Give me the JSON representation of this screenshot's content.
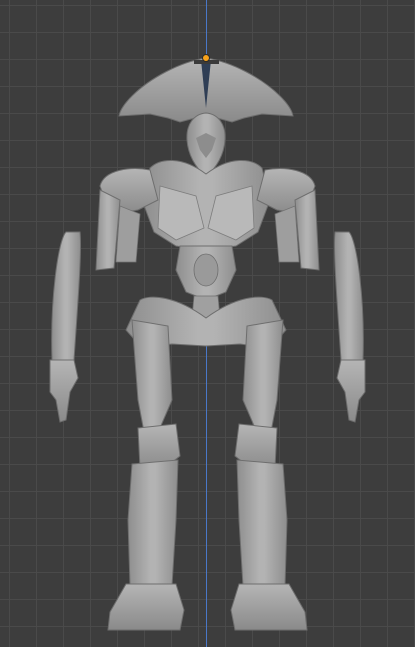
{
  "viewport": {
    "background_color": "#3d3d3d",
    "grid_color": "#4b4b4b",
    "axis_color": "#4a78c8",
    "origin_color": "#f7a21b"
  },
  "model": {
    "icon": "robot-mesh",
    "surface_color": "#a8a8a8",
    "shadow_color": "#7c7c7c",
    "highlight_color": "#c4c4c4"
  }
}
